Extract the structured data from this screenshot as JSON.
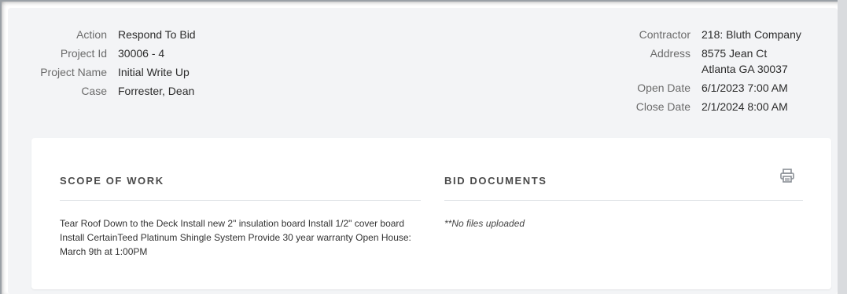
{
  "header_info": {
    "left": [
      {
        "label": "Action",
        "value": "Respond To Bid"
      },
      {
        "label": "Project Id",
        "value": "30006 - 4"
      },
      {
        "label": "Project Name",
        "value": "Initial Write Up"
      },
      {
        "label": "Case",
        "value": "Forrester, Dean"
      }
    ],
    "right": {
      "contractor": {
        "label": "Contractor",
        "value": "218: Bluth Company"
      },
      "address": {
        "label": "Address",
        "line1": "8575 Jean Ct",
        "line2": "Atlanta GA 30037"
      },
      "open_date": {
        "label": "Open Date",
        "value": "6/1/2023 7:00 AM"
      },
      "close_date": {
        "label": "Close Date",
        "value": "2/1/2024 8:00 AM"
      }
    }
  },
  "card": {
    "scope_of_work": {
      "title": "SCOPE OF WORK",
      "text": "Tear Roof Down to the Deck Install new 2\" insulation board Install 1/2\" cover board Install CertainTeed Platinum Shingle System Provide 30 year warranty Open House: March 9th at 1:00PM"
    },
    "bid_documents": {
      "title": "BID DOCUMENTS",
      "empty_text": "**No files uploaded"
    },
    "print_icon": "printer-icon"
  },
  "colors": {
    "page_background": "#f3f4f6",
    "card_background": "#ffffff",
    "divider": "#dcdfe3",
    "icon": "#8a8f96"
  }
}
